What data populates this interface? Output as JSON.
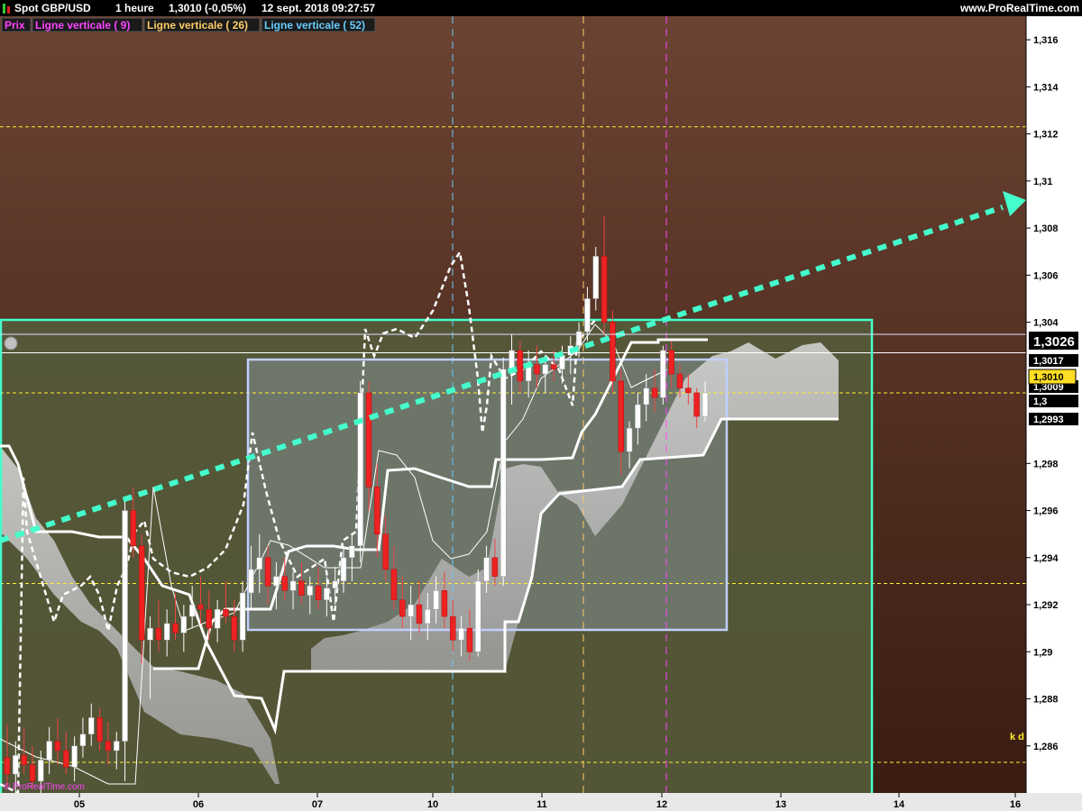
{
  "header": {
    "instrument": "Spot GBP/USD",
    "timeframe": "1 heure",
    "last_change": "1,3010 (-0,05%)",
    "datetime": "12 sept. 2018 09:27:57",
    "site": "www.ProRealTime.com"
  },
  "legend": [
    {
      "label": "Prix",
      "color": "#ff44ff"
    },
    {
      "label": "Ligne verticale ( 9)",
      "color": "#ff44ff"
    },
    {
      "label": "Ligne verticale ( 26)",
      "color": "#ffcc66"
    },
    {
      "label": "Ligne verticale ( 52)",
      "color": "#66ccff"
    }
  ],
  "watermark": "© ProRealTime.com",
  "kd_label": "k d",
  "chart_data": {
    "type": "candlestick",
    "y_axis": {
      "range": [
        1.284,
        1.317
      ],
      "ticks": [
        {
          "value": 1.316,
          "label": "1,316"
        },
        {
          "value": 1.314,
          "label": "1,314"
        },
        {
          "value": 1.312,
          "label": "1,312"
        },
        {
          "value": 1.31,
          "label": "1,31"
        },
        {
          "value": 1.308,
          "label": "1,308"
        },
        {
          "value": 1.306,
          "label": "1,306"
        },
        {
          "value": 1.304,
          "label": "1,304"
        },
        {
          "value": 1.298,
          "label": "1,298"
        },
        {
          "value": 1.296,
          "label": "1,296"
        },
        {
          "value": 1.294,
          "label": "1,294"
        },
        {
          "value": 1.292,
          "label": "1,292"
        },
        {
          "value": 1.29,
          "label": "1,29"
        },
        {
          "value": 1.288,
          "label": "1,288"
        },
        {
          "value": 1.286,
          "label": "1,286"
        }
      ],
      "value_tags": [
        {
          "value": 1.3026,
          "label": "1,3026",
          "style": "black"
        },
        {
          "value": 1.3017,
          "label": "1,3017",
          "style": "black"
        },
        {
          "value": 1.3009,
          "label": "1,3009",
          "style": "black"
        },
        {
          "value": 1.301,
          "label": "1,3010",
          "style": "yellow"
        },
        {
          "value": 1.3,
          "label": "1,3",
          "style": "black"
        },
        {
          "value": 1.2993,
          "label": "1,2993",
          "style": "black"
        }
      ]
    },
    "x_axis": {
      "labels": [
        "05",
        "06",
        "07",
        "10",
        "11",
        "12",
        "13",
        "14",
        "16"
      ]
    },
    "horizontal_lines": [
      {
        "value": 1.3123,
        "color": "#ffee33"
      },
      {
        "value": 1.301,
        "color": "#ffee33"
      },
      {
        "value": 1.2929,
        "color": "#ffee33"
      },
      {
        "value": 1.2853,
        "color": "#ffee33"
      },
      {
        "value": 1.3027,
        "color": "#ffffff"
      }
    ],
    "vertical_lines": [
      {
        "label": "Ligne verticale ( 52)",
        "x_label": "10",
        "color": "#66ccff"
      },
      {
        "label": "Ligne verticale ( 26)",
        "x_label": "11",
        "color": "#ffcc66"
      },
      {
        "label": "Ligne verticale ( 9)",
        "x_label": "12",
        "color": "#ff44ff"
      }
    ],
    "trend_arrow": {
      "from": {
        "x_label": "05",
        "value": 1.2937
      },
      "to": {
        "x_label": "16",
        "value": 1.3084
      },
      "color": "#44ffcc"
    },
    "rectangles": [
      {
        "name": "consolidation-range",
        "high": 1.3013,
        "low": 1.2902,
        "color": "#c0d0ff"
      },
      {
        "name": "green-zone",
        "high": 1.3035,
        "low": 1.284,
        "color": "#44ffcc"
      }
    ],
    "candles": [
      [
        1.2855,
        1.2869,
        1.2842,
        1.2848
      ],
      [
        1.2848,
        1.2862,
        1.284,
        1.2856
      ],
      [
        1.2856,
        1.2868,
        1.2848,
        1.2852
      ],
      [
        1.2852,
        1.286,
        1.2842,
        1.2845
      ],
      [
        1.2845,
        1.2858,
        1.284,
        1.2854
      ],
      [
        1.2854,
        1.2868,
        1.2848,
        1.2862
      ],
      [
        1.2862,
        1.2872,
        1.2852,
        1.2858
      ],
      [
        1.2858,
        1.2866,
        1.2848,
        1.2851
      ],
      [
        1.2851,
        1.2864,
        1.2845,
        1.286
      ],
      [
        1.286,
        1.2872,
        1.2855,
        1.2865
      ],
      [
        1.2865,
        1.2878,
        1.286,
        1.2872
      ],
      [
        1.2872,
        1.2876,
        1.2858,
        1.2862
      ],
      [
        1.2862,
        1.287,
        1.2852,
        1.2858
      ],
      [
        1.2858,
        1.2866,
        1.285,
        1.2862
      ],
      [
        1.2862,
        1.2965,
        1.2845,
        1.296
      ],
      [
        1.296,
        1.297,
        1.294,
        1.2945
      ],
      [
        1.2945,
        1.295,
        1.2895,
        1.2905
      ],
      [
        1.2905,
        1.2915,
        1.288,
        1.291
      ],
      [
        1.291,
        1.2922,
        1.29,
        1.2905
      ],
      [
        1.2905,
        1.2918,
        1.2898,
        1.2912
      ],
      [
        1.2912,
        1.2925,
        1.2905,
        1.2908
      ],
      [
        1.2908,
        1.292,
        1.29,
        1.2915
      ],
      [
        1.2915,
        1.2928,
        1.291,
        1.292
      ],
      [
        1.292,
        1.2932,
        1.2912,
        1.2918
      ],
      [
        1.2918,
        1.2926,
        1.2905,
        1.291
      ],
      [
        1.291,
        1.2922,
        1.2904,
        1.2918
      ],
      [
        1.2918,
        1.293,
        1.2912,
        1.2915
      ],
      [
        1.2915,
        1.2922,
        1.29,
        1.2905
      ],
      [
        1.2905,
        1.293,
        1.29,
        1.2925
      ],
      [
        1.2925,
        1.2945,
        1.2918,
        1.2935
      ],
      [
        1.2935,
        1.295,
        1.2925,
        1.294
      ],
      [
        1.294,
        1.2945,
        1.292,
        1.2928
      ],
      [
        1.2928,
        1.2938,
        1.2918,
        1.2932
      ],
      [
        1.2932,
        1.294,
        1.2922,
        1.2926
      ],
      [
        1.2926,
        1.2934,
        1.2918,
        1.293
      ],
      [
        1.293,
        1.2938,
        1.292,
        1.2924
      ],
      [
        1.2924,
        1.2932,
        1.2916,
        1.2928
      ],
      [
        1.2928,
        1.2936,
        1.2918,
        1.2922
      ],
      [
        1.2922,
        1.2932,
        1.2915,
        1.2927
      ],
      [
        1.2927,
        1.2936,
        1.292,
        1.293
      ],
      [
        1.293,
        1.2945,
        1.2925,
        1.294
      ],
      [
        1.294,
        1.295,
        1.293,
        1.2945
      ],
      [
        1.2945,
        1.3015,
        1.2938,
        1.301
      ],
      [
        1.301,
        1.3015,
        1.296,
        1.297
      ],
      [
        1.297,
        1.298,
        1.294,
        1.295
      ],
      [
        1.295,
        1.2958,
        1.293,
        1.2935
      ],
      [
        1.2935,
        1.2945,
        1.2918,
        1.2922
      ],
      [
        1.2922,
        1.2932,
        1.291,
        1.2915
      ],
      [
        1.2915,
        1.2928,
        1.2905,
        1.292
      ],
      [
        1.292,
        1.293,
        1.2908,
        1.2912
      ],
      [
        1.2912,
        1.2925,
        1.2905,
        1.2918
      ],
      [
        1.2918,
        1.2932,
        1.2912,
        1.2926
      ],
      [
        1.2926,
        1.2934,
        1.291,
        1.2915
      ],
      [
        1.2915,
        1.2922,
        1.29,
        1.2905
      ],
      [
        1.2905,
        1.2915,
        1.2898,
        1.291
      ],
      [
        1.291,
        1.2918,
        1.2896,
        1.29
      ],
      [
        1.29,
        1.2935,
        1.2898,
        1.293
      ],
      [
        1.293,
        1.2945,
        1.2925,
        1.294
      ],
      [
        1.294,
        1.2948,
        1.2928,
        1.2932
      ],
      [
        1.2932,
        1.3025,
        1.2928,
        1.302
      ],
      [
        1.302,
        1.3035,
        1.3005,
        1.3028
      ],
      [
        1.3028,
        1.3032,
        1.301,
        1.3015
      ],
      [
        1.3015,
        1.3028,
        1.3008,
        1.3022
      ],
      [
        1.3022,
        1.303,
        1.3012,
        1.3018
      ],
      [
        1.3018,
        1.3026,
        1.301,
        1.3022
      ],
      [
        1.3022,
        1.3028,
        1.3015,
        1.302
      ],
      [
        1.302,
        1.303,
        1.3014,
        1.3026
      ],
      [
        1.3026,
        1.3034,
        1.3018,
        1.303
      ],
      [
        1.303,
        1.304,
        1.3025,
        1.3036
      ],
      [
        1.3036,
        1.3055,
        1.3032,
        1.305
      ],
      [
        1.305,
        1.3072,
        1.3045,
        1.3068
      ],
      [
        1.3068,
        1.3085,
        1.3035,
        1.304
      ],
      [
        1.304,
        1.3045,
        1.301,
        1.3015
      ],
      [
        1.3015,
        1.302,
        1.2975,
        1.2985
      ],
      [
        1.2985,
        1.2998,
        1.2978,
        1.2995
      ],
      [
        1.2995,
        1.301,
        1.2988,
        1.3005
      ],
      [
        1.3005,
        1.3018,
        1.2998,
        1.3012
      ],
      [
        1.3012,
        1.302,
        1.3002,
        1.3008
      ],
      [
        1.3008,
        1.303,
        1.3005,
        1.3028
      ],
      [
        1.3028,
        1.3032,
        1.3012,
        1.3018
      ],
      [
        1.3018,
        1.3022,
        1.3008,
        1.3012
      ],
      [
        1.3012,
        1.3018,
        1.3005,
        1.301
      ],
      [
        1.301,
        1.3012,
        1.2995,
        1.3
      ],
      [
        1.3,
        1.3015,
        1.2998,
        1.301
      ]
    ],
    "x_label_positions": [
      88,
      220,
      352,
      480,
      601,
      734,
      866,
      997,
      1126
    ]
  }
}
